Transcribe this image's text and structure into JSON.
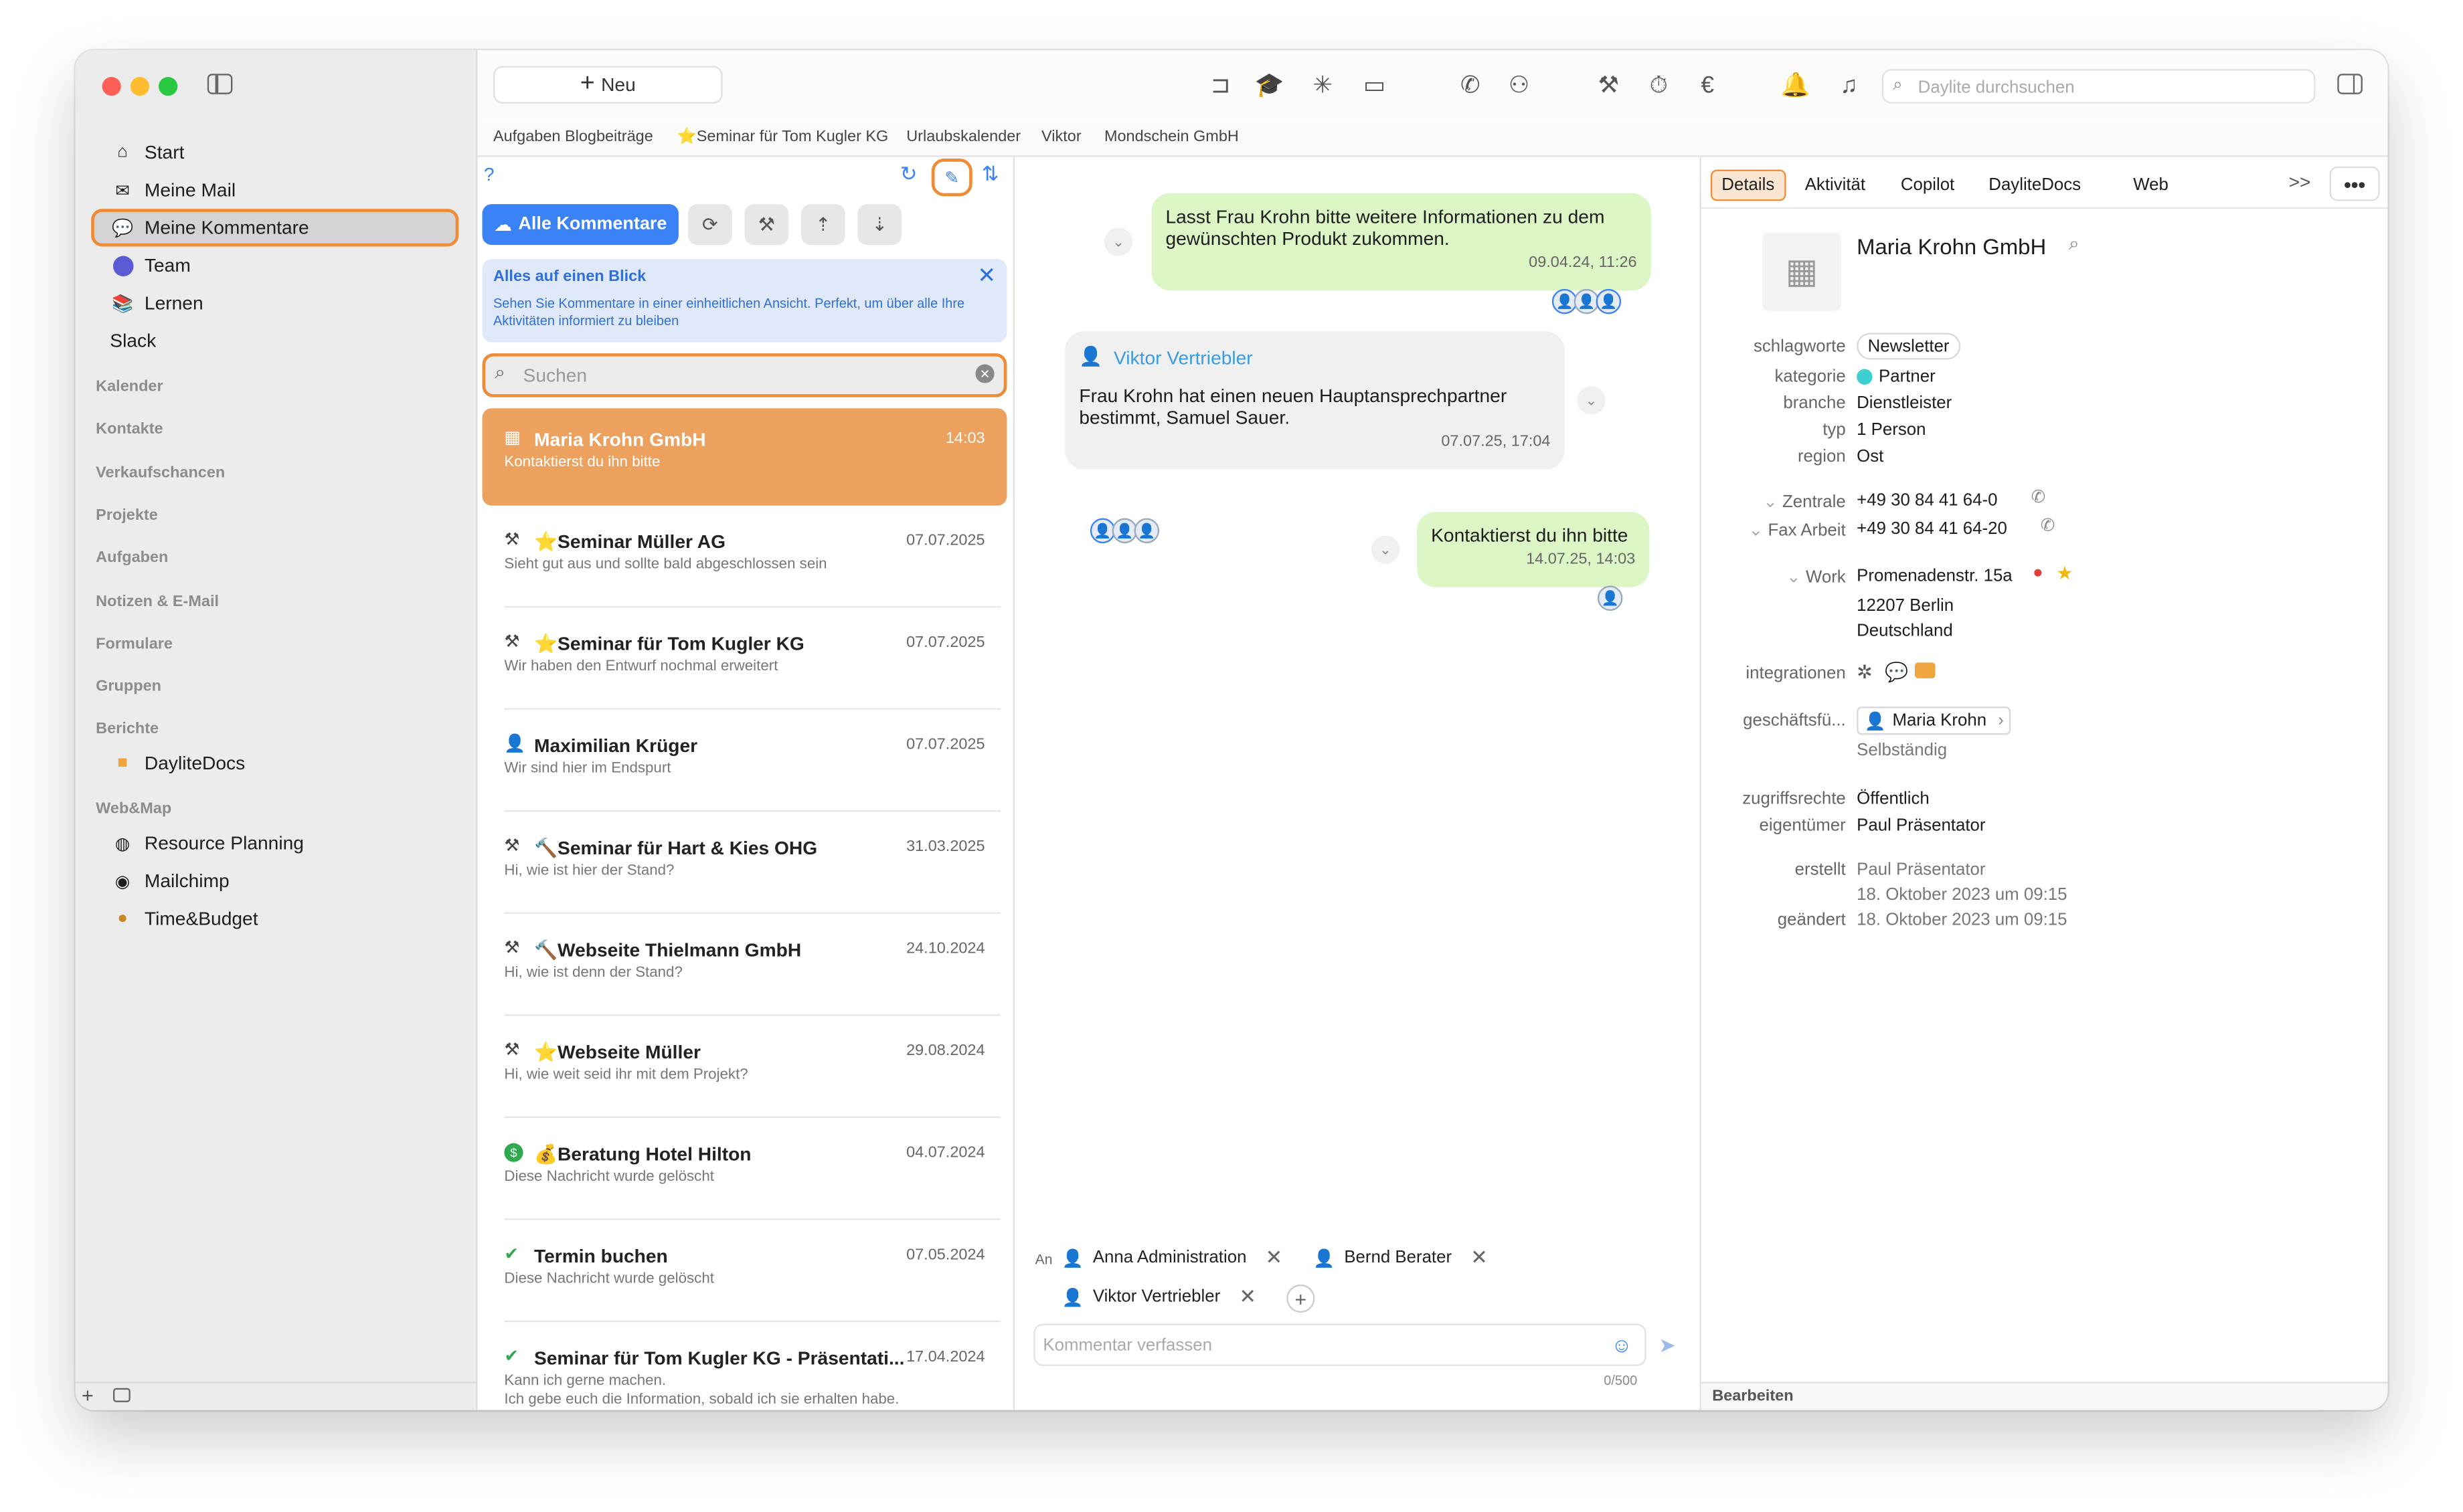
{
  "toolbar": {
    "new_label": "Neu",
    "search_placeholder": "Daylite durchsuchen"
  },
  "favorites": [
    "Aufgaben Blogbeiträge",
    "⭐️Seminar für Tom Kugler KG",
    "Urlaubskalender",
    "Viktor",
    "Mondschein GmbH"
  ],
  "sidebar": {
    "items": [
      "Start",
      "Meine Mail",
      "Meine Kommentare",
      "Team",
      "Lernen",
      "Slack"
    ],
    "sections": [
      "Kalender",
      "Kontakte",
      "Verkaufschancen",
      "Projekte",
      "Aufgaben",
      "Notizen & E-Mail",
      "Formulare",
      "Gruppen",
      "Berichte"
    ],
    "berichte_item": "DayliteDocs",
    "webmap_header": "Web&Map",
    "webmap_items": [
      "Resource Planning",
      "Mailchimp",
      "Time&Budget"
    ]
  },
  "list": {
    "help": "?",
    "all_button": "Alle Kommentare",
    "banner_title": "Alles auf einen Blick",
    "banner_text": "Sehen Sie Kommentare in einer einheitlichen Ansicht. Perfekt, um über alle Ihre Aktivitäten informiert zu bleiben",
    "search_placeholder": "Suchen",
    "rows": [
      {
        "title": "Maria Krohn GmbH",
        "date": "14:03",
        "snippet": "Kontaktierst du ihn bitte",
        "icon": "building-icon"
      },
      {
        "title": "⭐Seminar Müller AG",
        "date": "07.07.2025",
        "snippet": "Sieht gut aus und sollte bald abgeschlossen sein",
        "icon": "project-icon"
      },
      {
        "title": "⭐Seminar für Tom Kugler KG",
        "date": "07.07.2025",
        "snippet": "Wir haben den Entwurf nochmal erweitert",
        "icon": "project-icon"
      },
      {
        "title": "Maximilian Krüger",
        "date": "07.07.2025",
        "snippet": "Wir sind hier im Endspurt",
        "icon": "person-icon"
      },
      {
        "title": "🔨Seminar für Hart & Kies OHG",
        "date": "31.03.2025",
        "snippet": "Hi, wie ist hier der Stand?",
        "icon": "project-icon"
      },
      {
        "title": "🔨Webseite Thielmann GmbH",
        "date": "24.10.2024",
        "snippet": "Hi, wie ist denn der Stand?",
        "icon": "project-icon"
      },
      {
        "title": "⭐Webseite Müller",
        "date": "29.08.2024",
        "snippet": "Hi, wie weit seid ihr mit dem Projekt?",
        "icon": "project-icon"
      },
      {
        "title": "💰Beratung Hotel Hilton",
        "date": "04.07.2024",
        "snippet": "Diese Nachricht wurde gelöscht",
        "icon": "dollar-icon"
      },
      {
        "title": "Termin buchen",
        "date": "07.05.2024",
        "snippet": "Diese Nachricht wurde gelöscht",
        "icon": "check-icon"
      },
      {
        "title": "Seminar für Tom Kugler KG - Präsentati...",
        "date": "17.04.2024",
        "snippet": "Kann ich gerne machen.\nIch gebe euch die Information, sobald ich sie erhalten habe.",
        "icon": "check-icon"
      }
    ]
  },
  "chat": {
    "messages": [
      {
        "text": "Lasst Frau Krohn bitte weitere Informationen zu dem gewünschten Produkt zukommen.",
        "date": "09.04.24, 11:26"
      },
      {
        "author": "Viktor Vertriebler",
        "text": "Frau Krohn hat einen neuen Hauptansprechpartner bestimmt, Samuel Sauer.",
        "date": "07.07.25, 17:04"
      },
      {
        "text": "Kontaktierst du ihn bitte",
        "date": "14.07.25, 14:03"
      }
    ],
    "to_label": "An",
    "recipients": [
      "Anna Administration",
      "Bernd Berater",
      "Viktor Vertriebler"
    ],
    "compose_placeholder": "Kommentar verfassen",
    "counter": "0/500"
  },
  "detail": {
    "tabs": [
      "Details",
      "Aktivität",
      "Copilot",
      "DayliteDocs",
      "Web"
    ],
    "more": ">>",
    "name": "Maria Krohn GmbH",
    "fields": [
      {
        "label": "schlagworte",
        "value": "Newsletter"
      },
      {
        "label": "kategorie",
        "value": "Partner"
      },
      {
        "label": "branche",
        "value": "Dienstleister"
      },
      {
        "label": "typ",
        "value": "1 Person"
      },
      {
        "label": "region",
        "value": "Ost"
      }
    ],
    "phones": [
      {
        "label": "Zentrale",
        "value": "+49 30 84 41 64-0"
      },
      {
        "label": "Fax Arbeit",
        "value": "+49 30 84 41 64-20"
      }
    ],
    "address_label": "Work",
    "address": [
      "Promenadenstr. 15a",
      "12207 Berlin",
      "Deutschland"
    ],
    "integrations_label": "integrationen",
    "ceo_label": "geschäftsfü...",
    "ceo_name": "Maria Krohn",
    "ceo_role": "Selbständig",
    "access_label": "zugriffsrechte",
    "access_value": "Öffentlich",
    "owner_label": "eigentümer",
    "owner_value": "Paul Präsentator",
    "created_label": "erstellt",
    "created_by": "Paul Präsentator",
    "created_at": "18. Oktober 2023 um 09:15",
    "changed_label": "geändert",
    "changed_at": "18. Oktober 2023 um 09:15",
    "footer": "Bearbeiten"
  },
  "colors": {
    "accent": "#ee8d38",
    "selected_row": "#eca15e",
    "blue": "#3b82f6",
    "bubble_green": "#dcf7c5"
  }
}
